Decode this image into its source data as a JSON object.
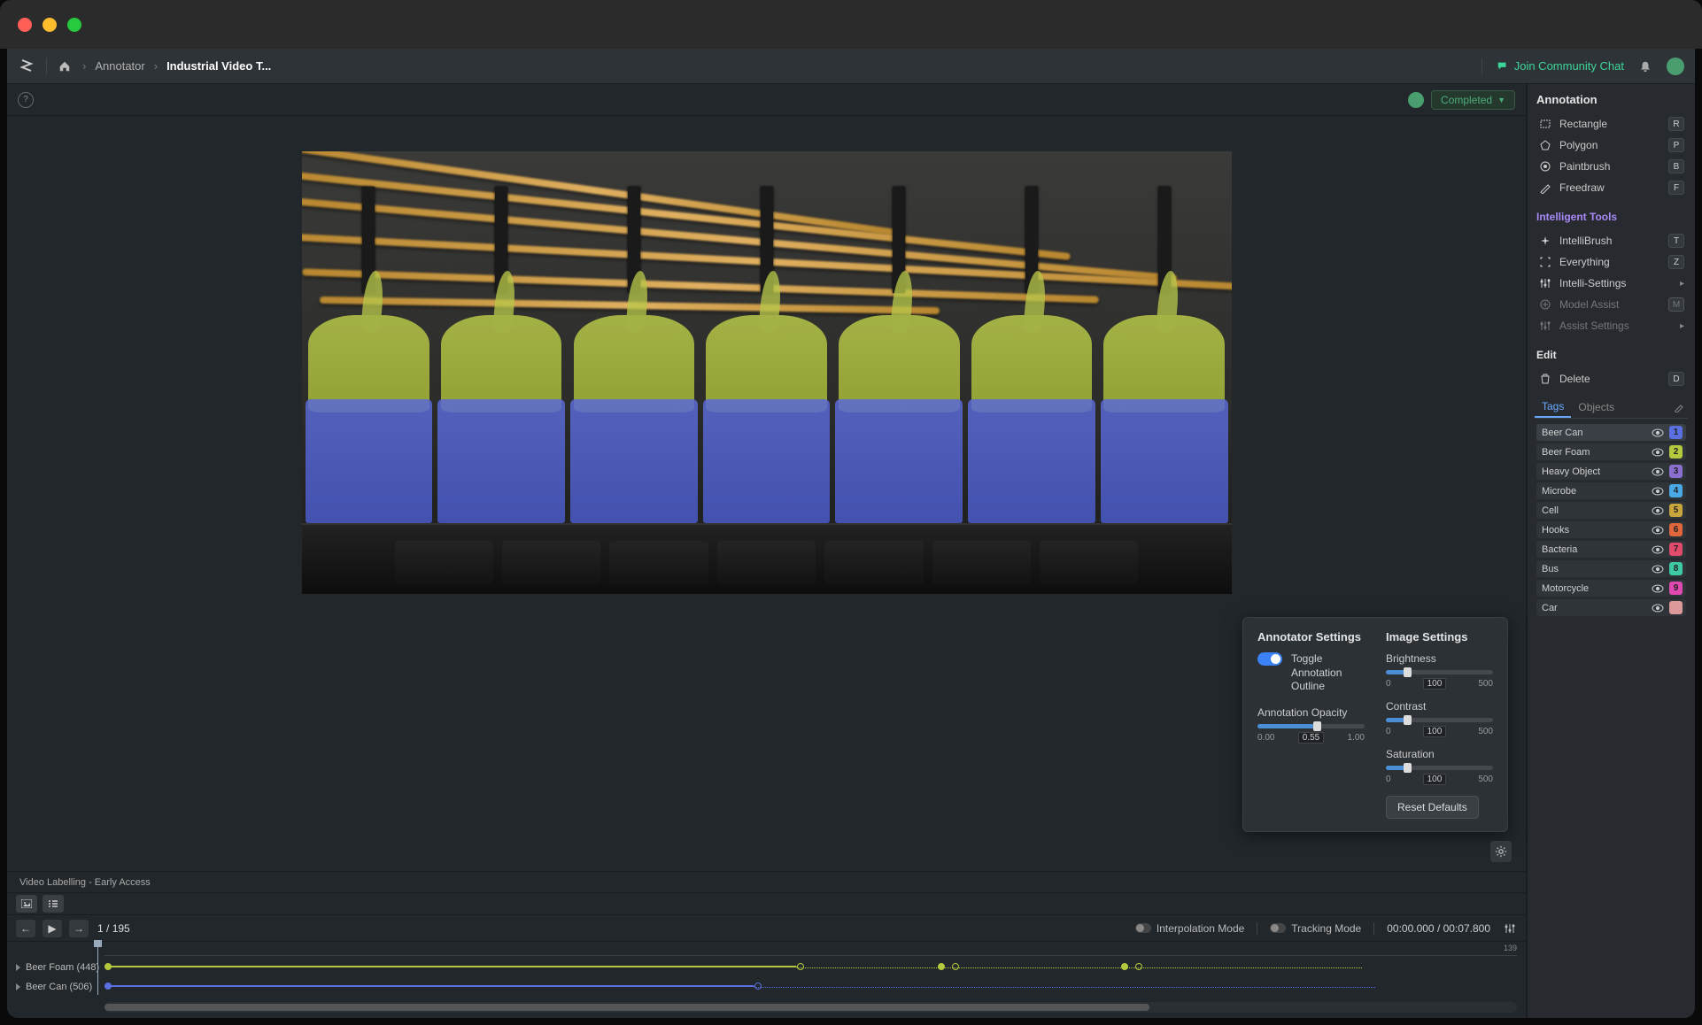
{
  "window": {
    "breadcrumb": {
      "annotator": "Annotator",
      "project": "Industrial Video T..."
    },
    "community_chat": "Join Community Chat",
    "status": "Completed"
  },
  "sidebar": {
    "annotation_title": "Annotation",
    "tools": [
      {
        "name": "Rectangle",
        "key": "R"
      },
      {
        "name": "Polygon",
        "key": "P"
      },
      {
        "name": "Paintbrush",
        "key": "B"
      },
      {
        "name": "Freedraw",
        "key": "F"
      }
    ],
    "intelligent_title": "Intelligent Tools",
    "intelli_tools": [
      {
        "name": "IntelliBrush",
        "key": "T"
      },
      {
        "name": "Everything",
        "key": "Z"
      },
      {
        "name": "Intelli-Settings",
        "arrow": true
      },
      {
        "name": "Model Assist",
        "key": "M",
        "muted": true
      },
      {
        "name": "Assist Settings",
        "arrow": true,
        "muted": true
      }
    ],
    "edit_title": "Edit",
    "edit_tools": [
      {
        "name": "Delete",
        "key": "D"
      }
    ],
    "tabs": {
      "tags": "Tags",
      "objects": "Objects"
    },
    "tags": [
      {
        "name": "Beer Can",
        "num": "1",
        "color": "#5a6fe0"
      },
      {
        "name": "Beer Foam",
        "num": "2",
        "color": "#b4c93e"
      },
      {
        "name": "Heavy Object",
        "num": "3",
        "color": "#8a6fd0"
      },
      {
        "name": "Microbe",
        "num": "4",
        "color": "#4aa8e6"
      },
      {
        "name": "Cell",
        "num": "5",
        "color": "#c9a53e"
      },
      {
        "name": "Hooks",
        "num": "6",
        "color": "#e0663e"
      },
      {
        "name": "Bacteria",
        "num": "7",
        "color": "#e04a6b"
      },
      {
        "name": "Bus",
        "num": "8",
        "color": "#3ec9a5"
      },
      {
        "name": "Motorcycle",
        "num": "9",
        "color": "#e04ab0"
      },
      {
        "name": "Car",
        "num": "",
        "color": "#d99"
      }
    ]
  },
  "settings_popup": {
    "annotator_title": "Annotator Settings",
    "toggle_label": "Toggle Annotation Outline",
    "toggle_on": true,
    "opacity_label": "Annotation Opacity",
    "opacity": {
      "min": "0.00",
      "val": "0.55",
      "max": "1.00",
      "pct": 55
    },
    "image_title": "Image Settings",
    "brightness_label": "Brightness",
    "brightness": {
      "min": "0",
      "val": "100",
      "max": "500",
      "pct": 20
    },
    "contrast_label": "Contrast",
    "contrast": {
      "min": "0",
      "val": "100",
      "max": "500",
      "pct": 20
    },
    "saturation_label": "Saturation",
    "saturation": {
      "min": "0",
      "val": "100",
      "max": "500",
      "pct": 20
    },
    "reset": "Reset Defaults"
  },
  "timeline": {
    "video_label": "Video Labelling - Early Access",
    "frame_current": "1",
    "frame_total": "195",
    "interpolation": "Interpolation Mode",
    "tracking": "Tracking Mode",
    "timecode": "00:00.000 / 00:07.800",
    "ruler_end": "139",
    "tracks": [
      {
        "name": "Beer Foam (448)",
        "color": "#b4c93e"
      },
      {
        "name": "Beer Can (506)",
        "color": "#5a6fe0"
      }
    ]
  }
}
